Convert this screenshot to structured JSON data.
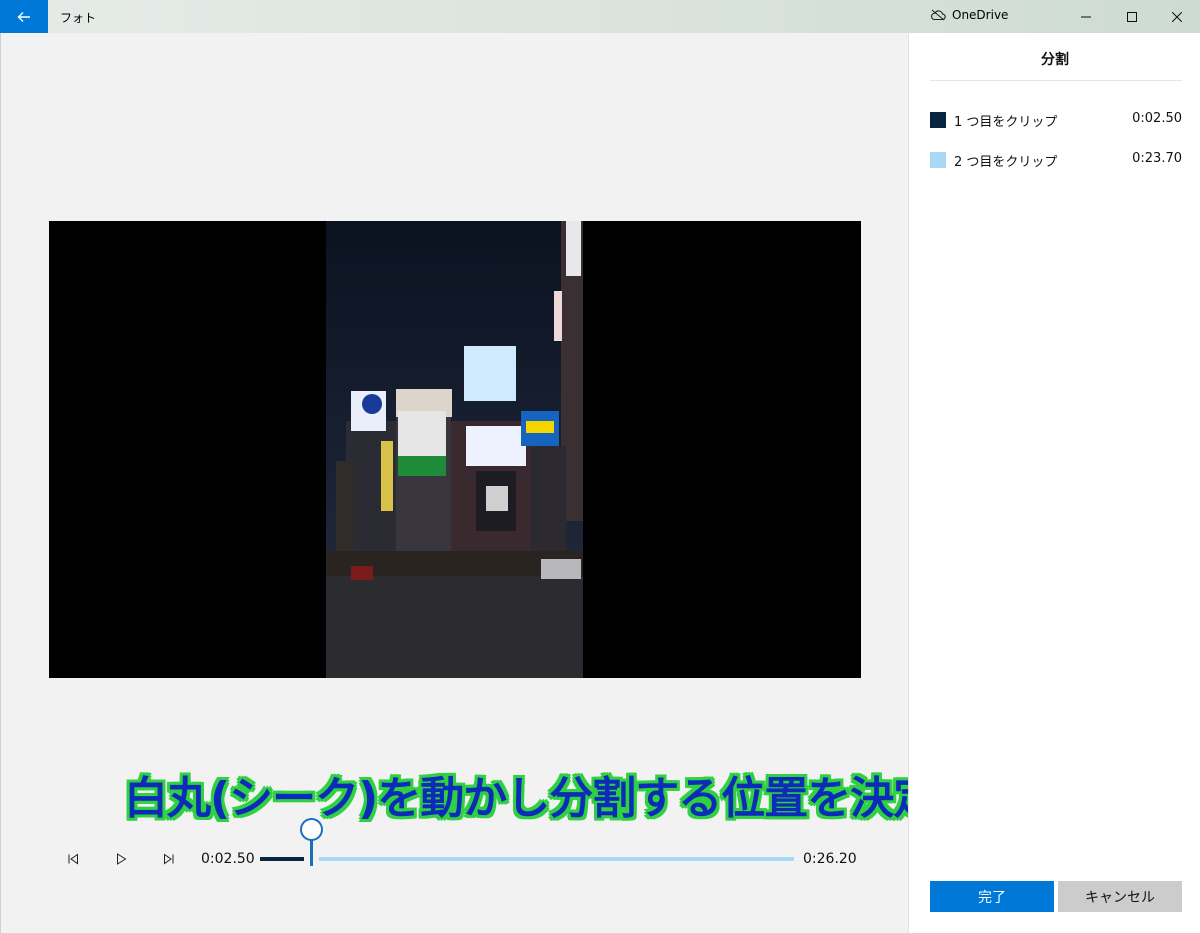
{
  "titlebar": {
    "app_title": "フォト",
    "onedrive_label": "OneDrive"
  },
  "caption": {
    "text": "白丸(シーク)を動かし分割する位置を決定"
  },
  "playback": {
    "current_time": "0:02.50",
    "end_time": "0:26.20",
    "split_fraction": 0.095
  },
  "panel": {
    "title": "分割",
    "clips": [
      {
        "label": "1 つ目をクリップ",
        "time": "0:02.50",
        "color": "#0a2540"
      },
      {
        "label": "2 つ目をクリップ",
        "time": "0:23.70",
        "color": "#a9d8f7"
      }
    ],
    "done_label": "完了",
    "cancel_label": "キャンセル"
  },
  "icons": [
    "back-arrow-icon",
    "cloud-off-icon",
    "minimize-icon",
    "maximize-icon",
    "close-icon",
    "previous-frame-icon",
    "play-icon",
    "next-frame-icon"
  ],
  "colors": {
    "accent": "#0078d7",
    "clip1": "#0a2540",
    "clip2": "#a9d8f7",
    "caption_text": "#0b2bb8",
    "caption_outline": "#2fd142"
  }
}
